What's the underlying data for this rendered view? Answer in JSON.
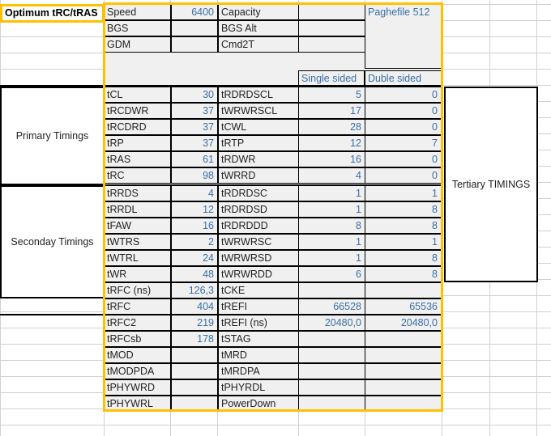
{
  "sheet": {
    "optimum_title": "Optimum tRC/tRAS",
    "tertiary_label": "Tertiary TIMINGS",
    "section_primary": "Primary Timings",
    "section_secondary": "Seconday Timings",
    "col_headers": {
      "single_sided": "Single sided",
      "double_sided": "Duble sided"
    },
    "top_block": [
      {
        "label": "Speed",
        "value": "6400",
        "label2": "Capacity",
        "value2": "",
        "note": "Paghefile 512"
      },
      {
        "label": "BGS",
        "value": "",
        "label2": "BGS Alt",
        "value2": "",
        "note": ""
      },
      {
        "label": "GDM",
        "value": "",
        "label2": "Cmd2T",
        "value2": "",
        "note": ""
      }
    ],
    "primary_rows": [
      {
        "label": "tCL",
        "value": "30",
        "label2": "tRDRDSCL",
        "single": "5",
        "double": "0"
      },
      {
        "label": "tRCDWR",
        "value": "37",
        "label2": "tWRWRSCL",
        "single": "17",
        "double": "0"
      },
      {
        "label": "tRCDRD",
        "value": "37",
        "label2": "tCWL",
        "single": "28",
        "double": "0"
      },
      {
        "label": "tRP",
        "value": "37",
        "label2": "tRTP",
        "single": "12",
        "double": "7"
      },
      {
        "label": "tRAS",
        "value": "61",
        "label2": "tRDWR",
        "single": "16",
        "double": "0"
      },
      {
        "label": "tRC",
        "value": "98",
        "label2": "tWRRD",
        "single": "4",
        "double": "0"
      }
    ],
    "secondary_rows": [
      {
        "label": "tRRDS",
        "value": "4",
        "label2": "tRDRDSC",
        "single": "1",
        "double": "1"
      },
      {
        "label": "tRRDL",
        "value": "12",
        "label2": "tRDRDSD",
        "single": "1",
        "double": "8"
      },
      {
        "label": "tFAW",
        "value": "16",
        "label2": "tRDRDDD",
        "single": "8",
        "double": "8"
      },
      {
        "label": "tWTRS",
        "value": "2",
        "label2": "tWRWRSC",
        "single": "1",
        "double": "1"
      },
      {
        "label": "tWTRL",
        "value": "24",
        "label2": "tWRWRSD",
        "single": "1",
        "double": "8"
      },
      {
        "label": "tWR",
        "value": "48",
        "label2": "tWRWRDD",
        "single": "6",
        "double": "8"
      },
      {
        "label": "tRFC (ns)",
        "value": "126,3",
        "label2": "tCKE",
        "single": "",
        "double": ""
      },
      {
        "label": "tRFC",
        "value": "404",
        "label2": "tREFI",
        "single": "66528",
        "double": "65536"
      }
    ],
    "tertiary_rows": [
      {
        "label": "tRFC2",
        "value": "219",
        "label2": "tREFI (ns)",
        "single": "20480,0",
        "double": "20480,0"
      },
      {
        "label": "tRFCsb",
        "value": "178",
        "label2": "tSTAG",
        "single": "",
        "double": ""
      },
      {
        "label": "tMOD",
        "value": "",
        "label2": "tMRD",
        "single": "",
        "double": ""
      },
      {
        "label": "tMODPDA",
        "value": "",
        "label2": "tMRDPA",
        "single": "",
        "double": ""
      },
      {
        "label": "tPHYWRD",
        "value": "",
        "label2": "tPHYRDL",
        "single": "",
        "double": ""
      },
      {
        "label": "tPHYWRL",
        "value": "",
        "label2": "PowerDown",
        "single": "",
        "double": ""
      }
    ],
    "colors": {
      "accent_gold": "#ffc000",
      "value_blue": "#3b6ea5",
      "cell_fill": "#f0f0f0",
      "gridline": "#d0d0d0"
    }
  }
}
